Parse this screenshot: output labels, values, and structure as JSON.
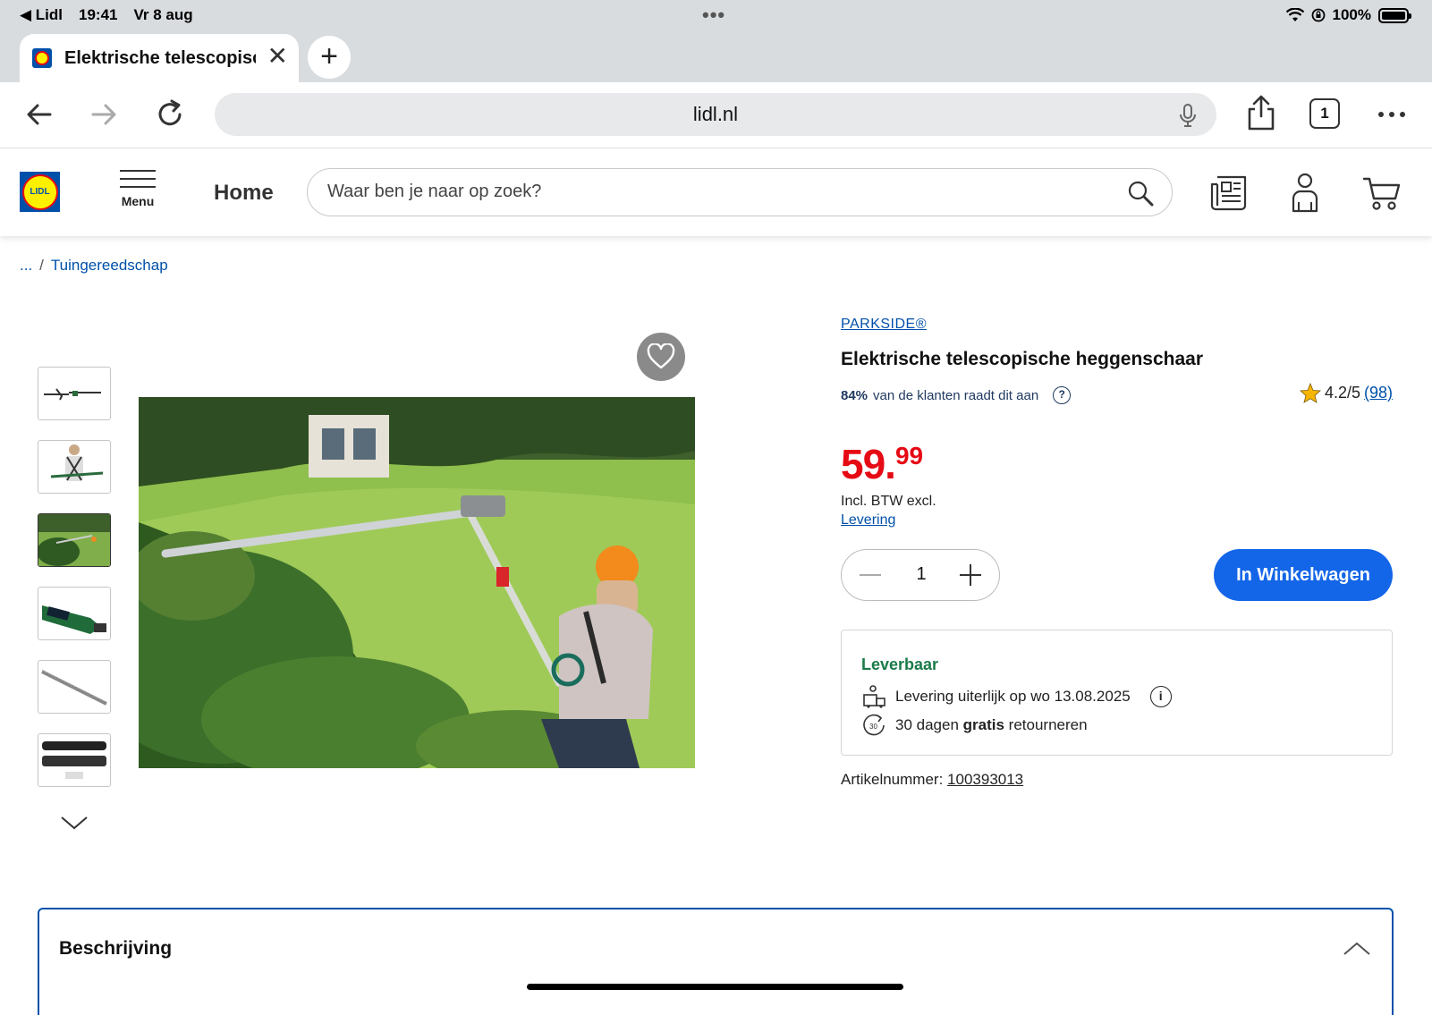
{
  "status_bar": {
    "back_app": "Lidl",
    "time": "19:41",
    "date": "Vr 8 aug",
    "battery": "100%"
  },
  "browser": {
    "tab_title": "Elektrische telescopische heggenschaar",
    "url": "lidl.nl",
    "tab_count": "1"
  },
  "site_header": {
    "logo_text": "LIDL",
    "menu_label": "Menu",
    "home_label": "Home",
    "search_placeholder": "Waar ben je naar op zoek?"
  },
  "breadcrumb": {
    "ellipsis": "...",
    "separator": "/",
    "category": "Tuingereedschap"
  },
  "product": {
    "brand": "PARKSIDE®",
    "title": "Elektrische telescopische heggenschaar",
    "recommend_pct": "84%",
    "recommend_text": "van de klanten raadt dit aan",
    "rating": "4.2/5",
    "review_count": "(98)",
    "price_main": "59.",
    "price_cents": "99",
    "vat_text": "Incl. BTW excl.",
    "delivery_link": "Levering",
    "quantity": "1",
    "add_to_cart": "In Winkelwagen",
    "availability": "Leverbaar",
    "delivery_date_text": "Levering uiterlijk op wo 13.08.2025",
    "return_prefix": "30 dagen",
    "return_bold": "gratis",
    "return_suffix": "retourneren",
    "article_label": "Artikelnummer:",
    "article_number": "100393013"
  },
  "description": {
    "label": "Beschrijving"
  },
  "colors": {
    "lidl_blue": "#0050aa",
    "price_red": "#e60a14",
    "cta_blue": "#1466e8",
    "available_green": "#1b7a4a"
  }
}
